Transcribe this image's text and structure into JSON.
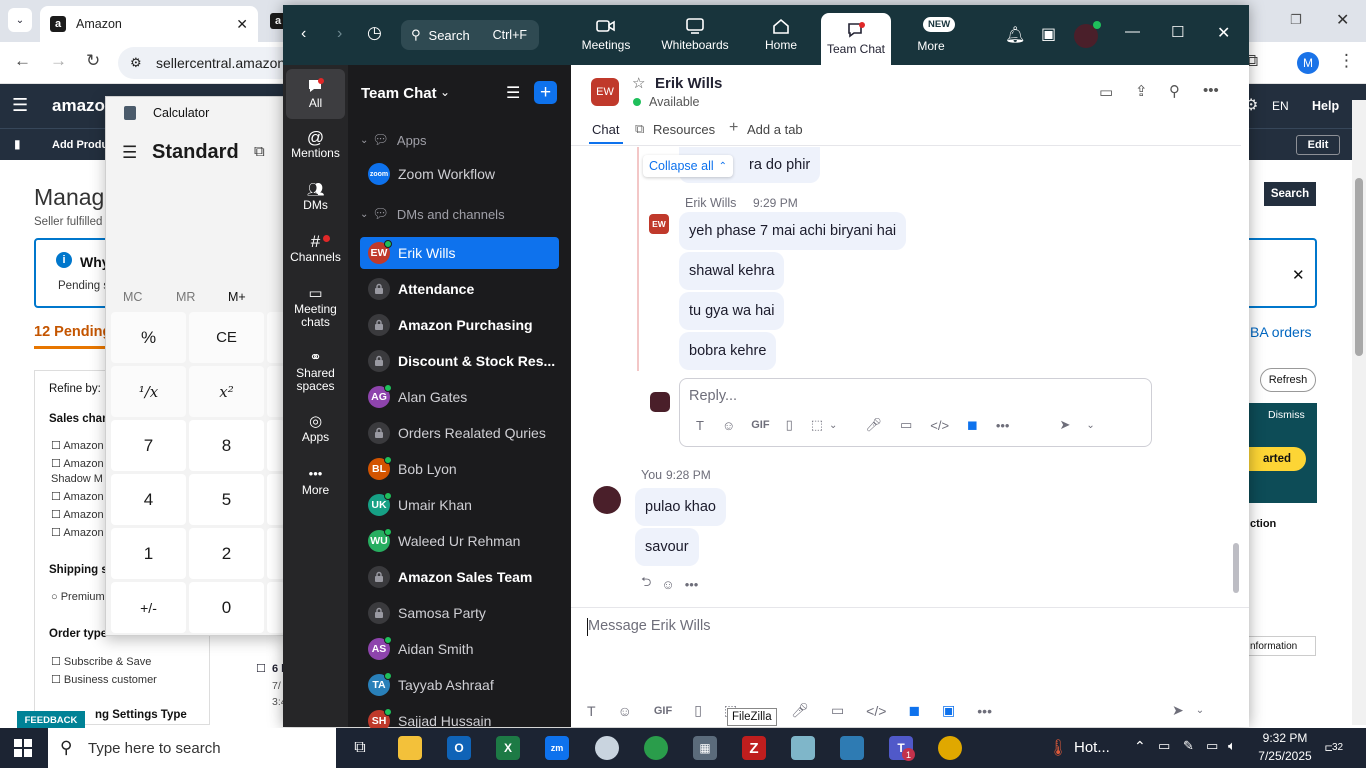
{
  "chrome": {
    "tab_title": "Amazon",
    "url": "sellercentral.amazon",
    "profile_initial": "M"
  },
  "amazon": {
    "logo": "amazon",
    "lang": "EN",
    "help": "Help",
    "add_products": "Add Produc",
    "edit": "Edit",
    "page_title": "Manage",
    "seller_fulfilled": "Seller fulfilled",
    "why_title": "Why",
    "pending_text": "Pending s",
    "pending_heading": "12 Pending",
    "fba_orders": "BA orders",
    "search_btn": "Search",
    "refresh": "Refresh",
    "dismiss": "Dismiss",
    "started": "arted",
    "action": "ction",
    "info_more": "nformation",
    "refine_by": "Refine by:",
    "sales_channel": "Sales chan",
    "filters_a": [
      "Amazon",
      "Amazon",
      "Shadow M",
      "Amazon",
      "Amazon",
      "Amazon"
    ],
    "shipping": "Shipping s",
    "premium": "Premium",
    "order_type": "Order type",
    "subscribe": "Subscribe & Save",
    "business": "Business customer",
    "ing_settings": "ng Settings Type",
    "feedback": "FEEDBACK",
    "row_num": "6 h",
    "row_a": "7/",
    "row_b": "3:4"
  },
  "calculator": {
    "title": "Calculator",
    "mode": "Standard",
    "memory": [
      "MC",
      "MR",
      "M+"
    ],
    "keys": [
      [
        "%",
        "CE"
      ],
      [
        "¹/x",
        "x²"
      ],
      [
        "7",
        "8"
      ],
      [
        "4",
        "5"
      ],
      [
        "1",
        "2"
      ],
      [
        "+/-",
        "0"
      ]
    ]
  },
  "zoom": {
    "search_label": "Search",
    "search_shortcut": "Ctrl+F",
    "top_tabs": [
      "Meetings",
      "Whiteboards",
      "Home",
      "Team Chat",
      "More"
    ],
    "new_badge": "NEW",
    "rail": [
      "All",
      "Mentions",
      "DMs",
      "Channels",
      "Meeting chats",
      "Shared spaces",
      "Apps",
      "More"
    ],
    "list_title": "Team Chat",
    "apps_section": "Apps",
    "zoom_workflow": "Zoom Workflow",
    "dm_section": "DMs and channels",
    "items": [
      {
        "name": "Erik Wills",
        "initials": "EW",
        "color": "#c0392b",
        "type": "dm",
        "bold": false,
        "selected": true
      },
      {
        "name": "Attendance",
        "type": "channel",
        "bold": true
      },
      {
        "name": "Amazon Purchasing",
        "type": "channel",
        "bold": true
      },
      {
        "name": "Discount & Stock Res...",
        "type": "channel",
        "bold": true
      },
      {
        "name": "Alan Gates",
        "initials": "AG",
        "color": "#8e44ad",
        "type": "dm",
        "bold": false
      },
      {
        "name": "Orders Realated Quries",
        "type": "channel",
        "bold": false
      },
      {
        "name": "Bob Lyon",
        "initials": "BL",
        "color": "#d35400",
        "type": "dm",
        "bold": false
      },
      {
        "name": "Umair Khan",
        "initials": "UK",
        "color": "#16a085",
        "type": "dm",
        "bold": false
      },
      {
        "name": "Waleed Ur Rehman",
        "initials": "WU",
        "color": "#27ae60",
        "type": "dm",
        "bold": false
      },
      {
        "name": "Amazon Sales Team",
        "type": "channel",
        "bold": true
      },
      {
        "name": "Samosa Party",
        "type": "channel",
        "bold": false
      },
      {
        "name": "Aidan Smith",
        "initials": "AS",
        "color": "#8e44ad",
        "type": "dm",
        "bold": false
      },
      {
        "name": "Tayyab Ashraaf",
        "initials": "TA",
        "color": "#2980b9",
        "type": "dm",
        "bold": false
      },
      {
        "name": "Sajjad Hussain",
        "initials": "SH",
        "color": "#c0392b",
        "type": "dm",
        "bold": false
      }
    ],
    "chat": {
      "contact": "Erik Wills",
      "initials": "EW",
      "status": "Available",
      "tabs": [
        "Chat",
        "Resources",
        "Add a tab"
      ],
      "collapse_all": "Collapse all",
      "thread_first": "ra do phir",
      "thread_author": "Erik Wills",
      "thread_time": "9:29 PM",
      "thread_msgs": [
        "yeh phase 7 mai achi biryani hai",
        "shawal kehra",
        "tu gya wa hai",
        "bobra kehre"
      ],
      "reply_placeholder": "Reply...",
      "you_label": "You",
      "you_time": "9:28 PM",
      "my_msgs": [
        "pulao khao",
        "savour"
      ],
      "composer_placeholder": "Message Erik Wills",
      "tooltip": "FileZilla",
      "gif": "GIF"
    }
  },
  "taskbar": {
    "search_placeholder": "Type here to search",
    "weather": "Hot...",
    "time": "9:32 PM",
    "date": "7/25/2025",
    "notif_count": "32",
    "teams_badge": "1"
  }
}
